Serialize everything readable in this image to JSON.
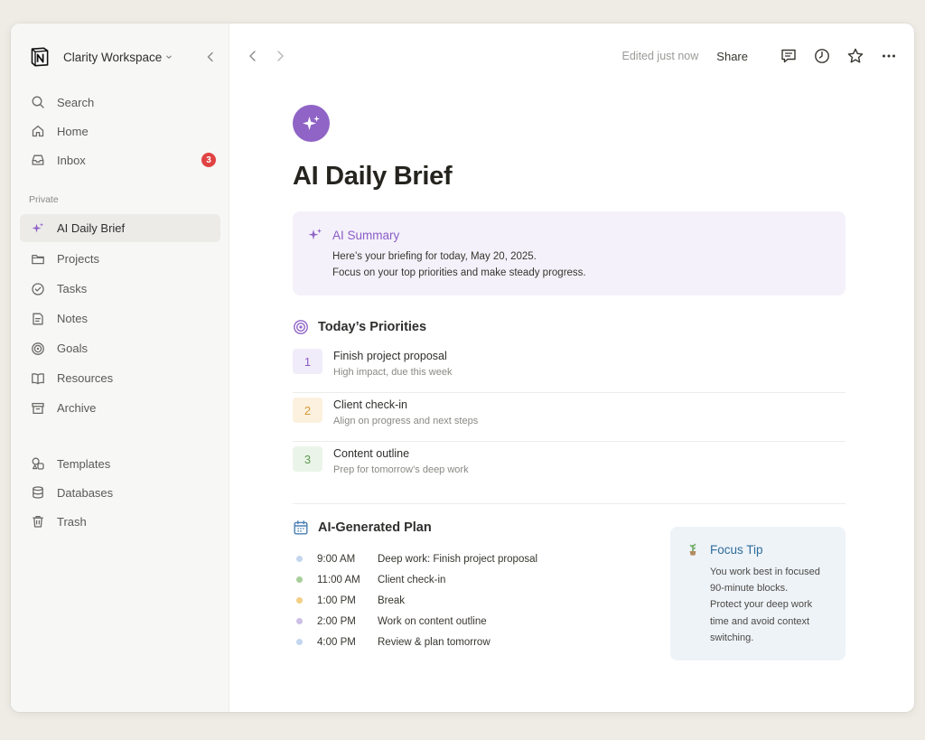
{
  "colors": {
    "accent_purple": "#8f64c6",
    "badge_red": "#e04343",
    "focus_blue": "#2f6d9a"
  },
  "sidebar": {
    "workspace_name": "Clarity Workspace",
    "workspace_icon": "notion-logo-icon",
    "top_items": [
      {
        "label": "Search",
        "icon": "search-icon"
      },
      {
        "label": "Home",
        "icon": "home-icon"
      },
      {
        "label": "Inbox",
        "icon": "inbox-icon",
        "badge": "3"
      }
    ],
    "section_label": "Private",
    "private_items": [
      {
        "label": "AI Daily Brief",
        "icon": "sparkle-icon",
        "active": true
      },
      {
        "label": "Projects",
        "icon": "folder-icon"
      },
      {
        "label": "Tasks",
        "icon": "check-circle-icon"
      },
      {
        "label": "Notes",
        "icon": "note-icon"
      },
      {
        "label": "Goals",
        "icon": "target-icon"
      },
      {
        "label": "Resources",
        "icon": "book-icon"
      },
      {
        "label": "Archive",
        "icon": "archive-icon"
      }
    ],
    "bottom_items": [
      {
        "label": "Templates",
        "icon": "templates-icon"
      },
      {
        "label": "Databases",
        "icon": "database-icon"
      },
      {
        "label": "Trash",
        "icon": "trash-icon"
      }
    ]
  },
  "topbar": {
    "edited": "Edited just now",
    "share": "Share"
  },
  "page": {
    "title": "AI Daily Brief",
    "icon": "sparkle-icon",
    "summary": {
      "title": "AI Summary",
      "line1": "Here’s your briefing for today, May 20, 2025.",
      "line2": "Focus on your top priorities and make steady progress."
    },
    "priorities": {
      "heading": "Today’s Priorities",
      "items": [
        {
          "num": "1",
          "title": "Finish project proposal",
          "sub": "High impact, due this week",
          "bg": "#f1ecfa",
          "fg": "#8a5cc7"
        },
        {
          "num": "2",
          "title": "Client check-in",
          "sub": "Align on progress and next steps",
          "bg": "#fcf1df",
          "fg": "#d49a3a"
        },
        {
          "num": "3",
          "title": "Content outline",
          "sub": "Prep for tomorrow’s deep work",
          "bg": "#ebf4e8",
          "fg": "#5b9a55"
        }
      ]
    },
    "plan": {
      "heading": "AI-Generated Plan",
      "items": [
        {
          "time": "9:00 AM",
          "task": "Deep work: Finish project proposal",
          "dot": "#c3d6ee"
        },
        {
          "time": "11:00 AM",
          "task": "Client check-in",
          "dot": "#a9cf9a"
        },
        {
          "time": "1:00 PM",
          "task": "Break",
          "dot": "#f3cf86"
        },
        {
          "time": "2:00 PM",
          "task": "Work on content outline",
          "dot": "#cdbfe6"
        },
        {
          "time": "4:00 PM",
          "task": "Review & plan tomorrow",
          "dot": "#c3d6ee"
        }
      ]
    },
    "focus_tip": {
      "title": "Focus Tip",
      "lines": [
        "You work best in focused",
        "90-minute blocks.",
        "Protect your deep work",
        "time and avoid context",
        "switching."
      ]
    }
  }
}
